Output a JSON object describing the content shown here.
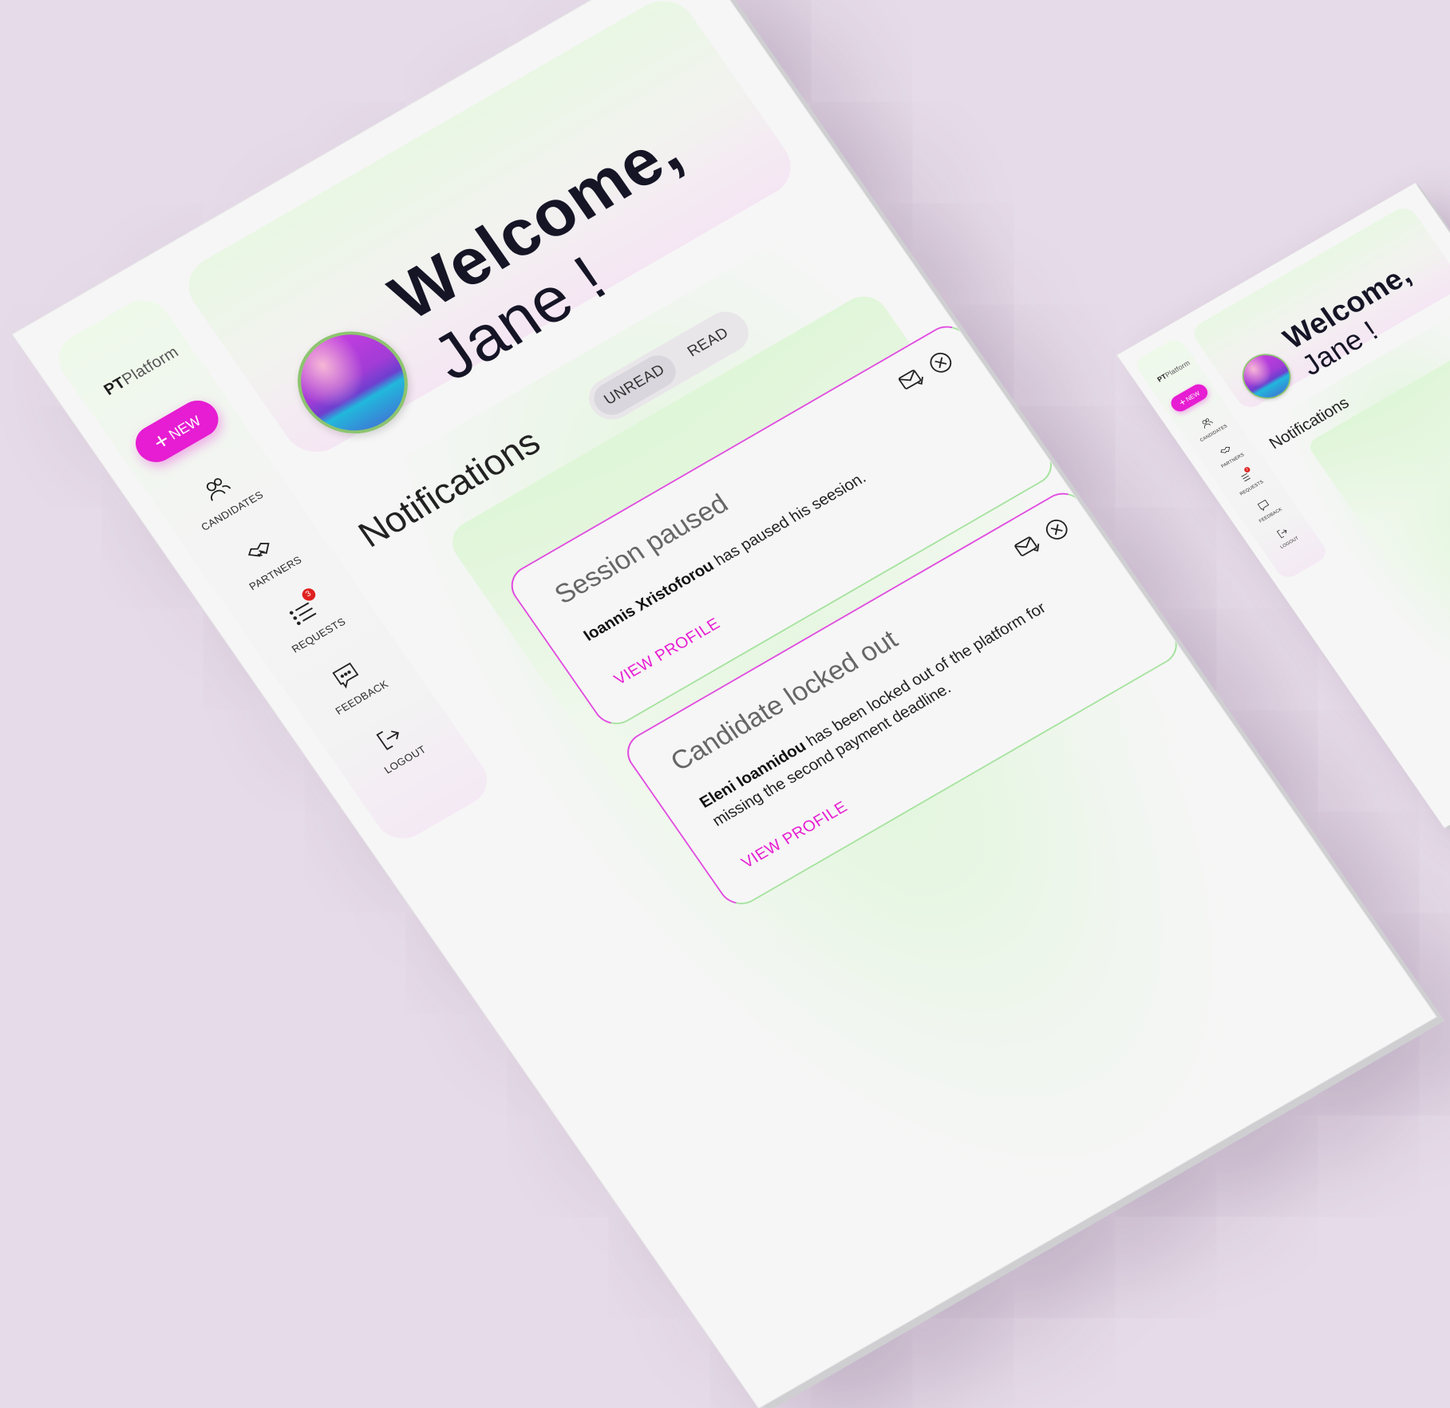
{
  "brand": {
    "bold": "PT",
    "rest": "Platform"
  },
  "sidebar": {
    "new_button": "NEW",
    "items": [
      {
        "label": "CANDIDATES",
        "icon": "users-icon"
      },
      {
        "label": "PARTNERS",
        "icon": "handshake-icon"
      },
      {
        "label": "REQUESTS",
        "icon": "list-icon",
        "badge": "3"
      },
      {
        "label": "FEEDBACK",
        "icon": "chat-icon"
      },
      {
        "label": "LOGOUT",
        "icon": "logout-icon"
      }
    ]
  },
  "header": {
    "greeting": "Welcome,",
    "name": "Jane !"
  },
  "notifications": {
    "title": "Notifications",
    "tabs": {
      "unread": "UNREAD",
      "read": "READ"
    },
    "items": [
      {
        "title": "Session paused",
        "name": "Ioannis Xristoforou",
        "message": "has paused his seesion.",
        "link": "VIEW PROFILE"
      },
      {
        "title": "Candidate locked out",
        "name": "Eleni Ioannidou",
        "message": "has been locked out of the platform for missing the second payment deadline.",
        "link": "VIEW PROFILE"
      }
    ]
  },
  "colors": {
    "accent": "#e61dd2",
    "badge": "#e02020",
    "background": "#e6dbe8"
  }
}
